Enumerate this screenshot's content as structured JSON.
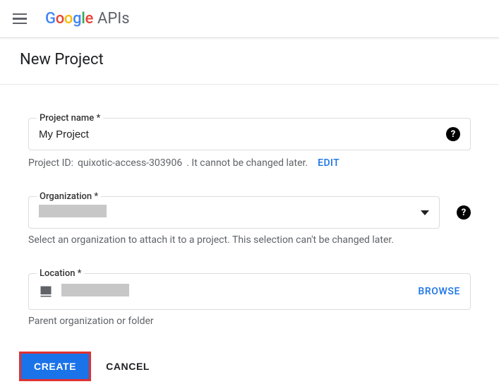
{
  "header": {
    "brand_text": "Google",
    "brand_suffix": "APIs"
  },
  "page": {
    "title": "New Project"
  },
  "form": {
    "project_name": {
      "label": "Project name *",
      "value": "My Project"
    },
    "project_id": {
      "prefix": "Project ID:",
      "id": "quixotic-access-303906",
      "note": ". It cannot be changed later.",
      "edit_label": "EDIT"
    },
    "organization": {
      "label": "Organization *",
      "helper": "Select an organization to attach it to a project. This selection can't be changed later."
    },
    "location": {
      "label": "Location *",
      "browse_label": "BROWSE",
      "helper": "Parent organization or folder"
    }
  },
  "actions": {
    "create": "CREATE",
    "cancel": "CANCEL"
  }
}
